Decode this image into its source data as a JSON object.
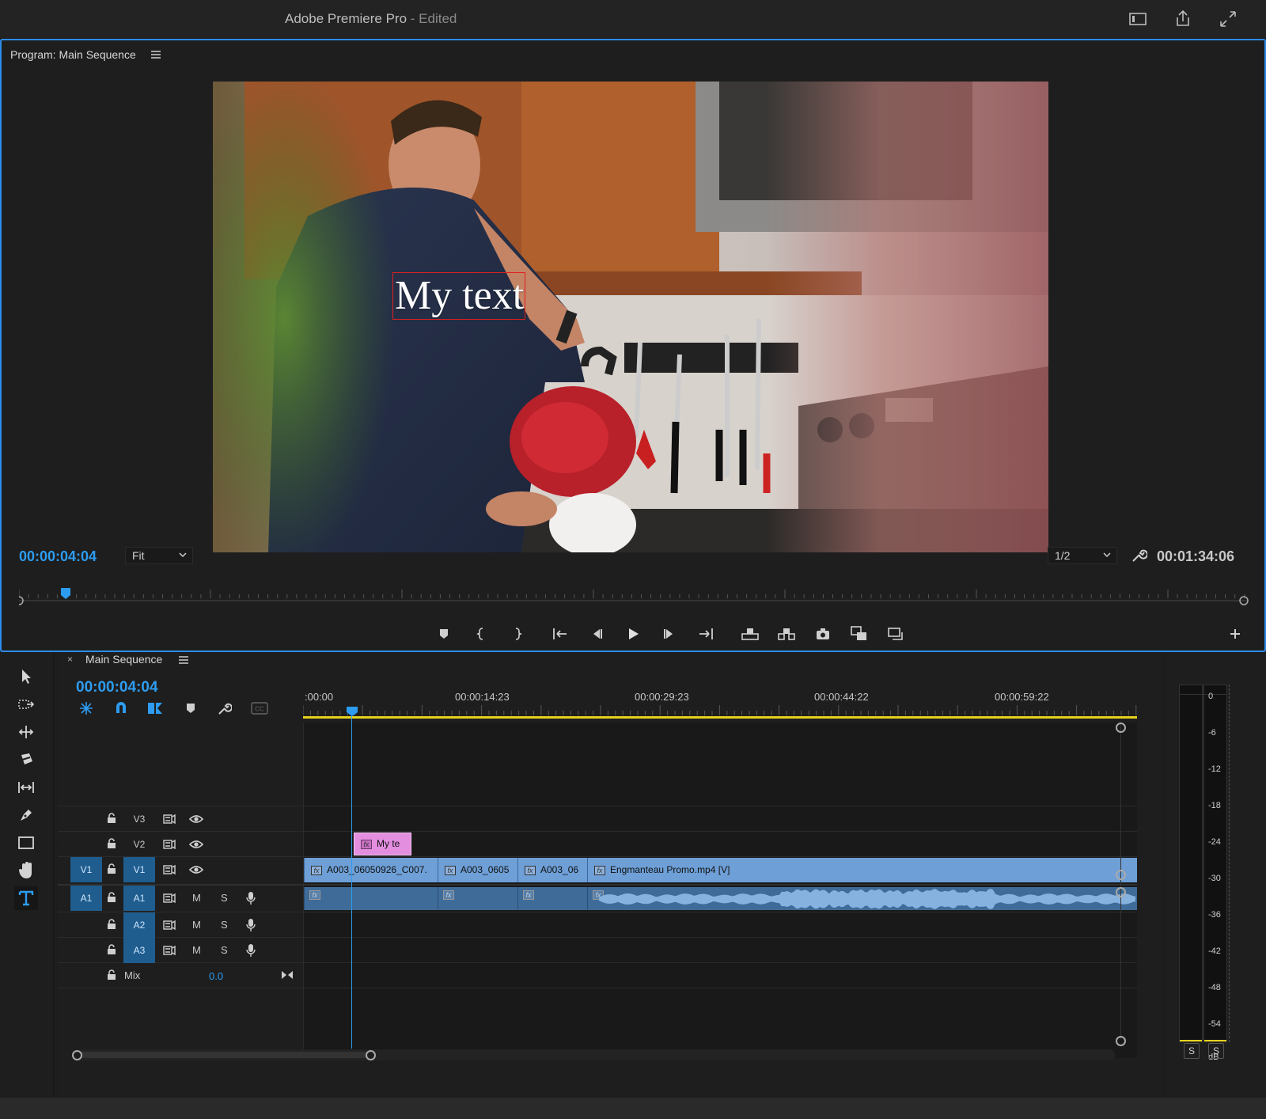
{
  "app": {
    "title": "Adobe Premiere Pro",
    "status": "- Edited"
  },
  "program": {
    "panel_title": "Program: Main Sequence",
    "overlay_text": "My text",
    "current_timecode": "00:00:04:04",
    "duration_timecode": "00:01:34:06",
    "zoom": "Fit",
    "resolution": "1/2"
  },
  "timeline": {
    "sequence_tab": "Main Sequence",
    "timecode": "00:00:04:04",
    "ruler": [
      ":00:00",
      "00:00:14:23",
      "00:00:29:23",
      "00:00:44:22",
      "00:00:59:22"
    ],
    "tracks": {
      "v3": "V3",
      "v2": "V2",
      "v1": "V1",
      "a1": "A1",
      "a2": "A2",
      "a3": "A3",
      "mix": "Mix",
      "mix_value": "0.0",
      "source_v1": "V1",
      "source_a1": "A1",
      "mute": "M",
      "solo": "S"
    },
    "clips": {
      "title_clip": "My te",
      "c1": "A003_06050926_C007.",
      "c2": "A003_0605",
      "c3": "A003_06",
      "c4": "Engmanteau Promo.mp4 [V]"
    },
    "fx_badge": "fx"
  },
  "meters": {
    "scale": [
      "0",
      "-6",
      "-12",
      "-18",
      "-24",
      "-30",
      "-36",
      "-42",
      "-48",
      "-54",
      "dB"
    ],
    "solo_left": "S",
    "solo_right": "S"
  },
  "colors": {
    "accent_blue": "#2d9cf0",
    "video_clip": "#6e9fd6",
    "audio_clip": "#3e6b98",
    "title_clip": "#e48ee0",
    "work_area": "#e6d21c",
    "selection_box": "#e02020"
  }
}
